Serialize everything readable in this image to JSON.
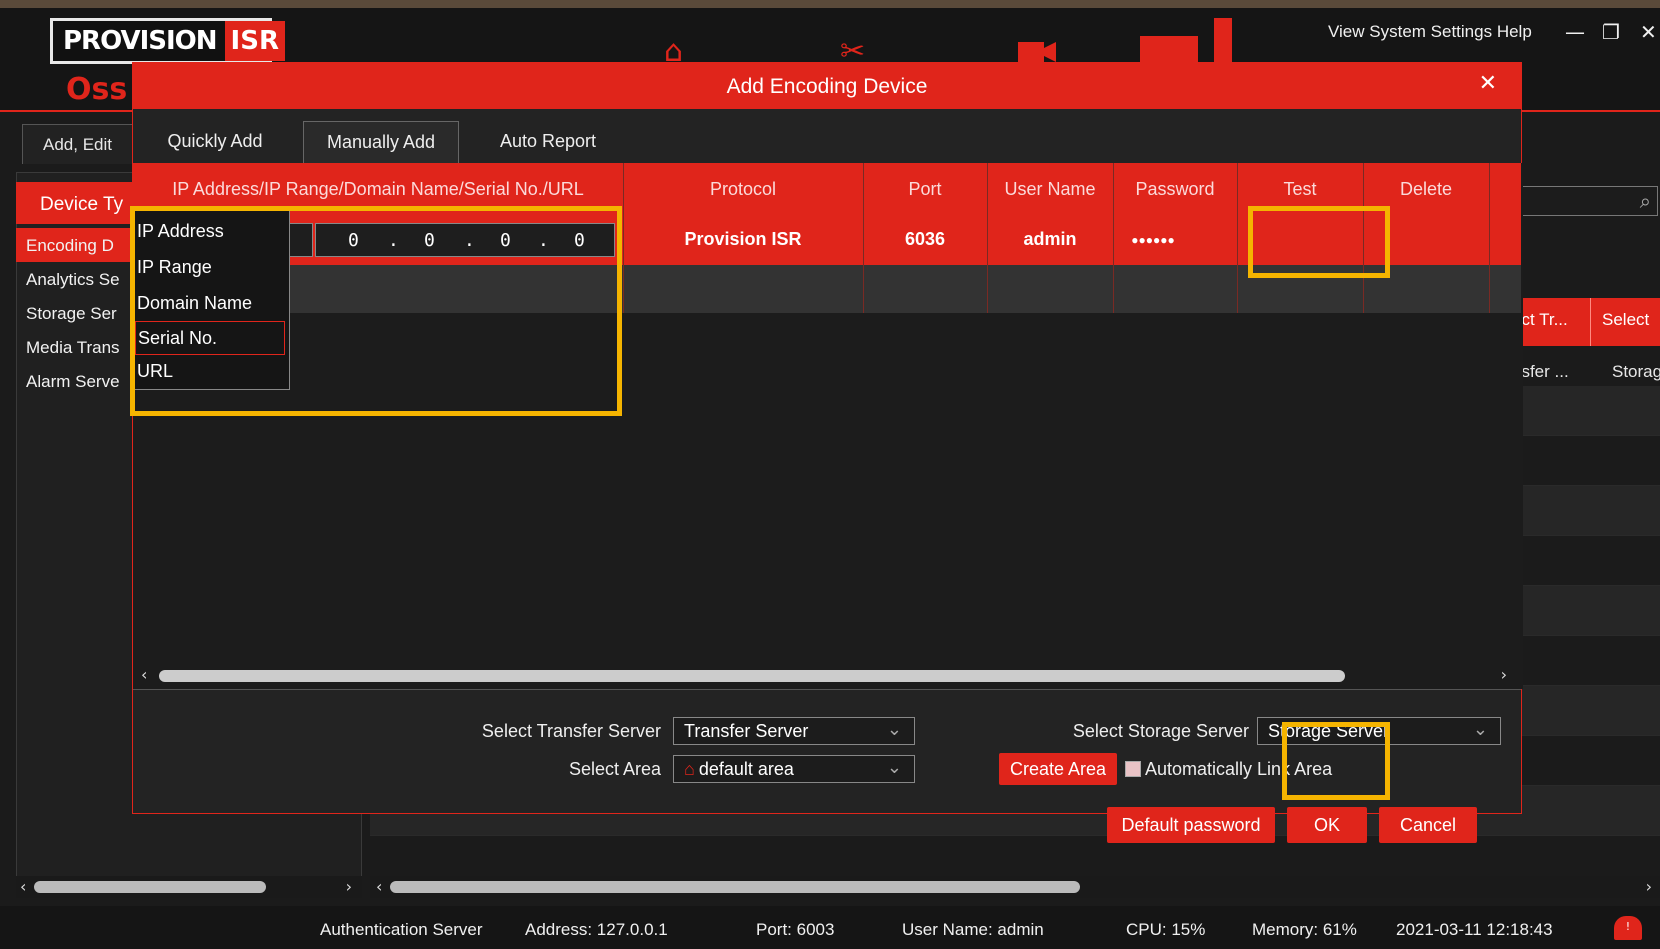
{
  "app": {
    "logo_text": "PROVISION",
    "logo_isr": "ISR",
    "app_name": "Oss",
    "system_menu": "View System Settings Help"
  },
  "sidebar": {
    "tab_label": "Add, Edit",
    "header": "Device Ty",
    "items": [
      {
        "label": "Encoding D"
      },
      {
        "label": "Analytics Se"
      },
      {
        "label": "Storage Ser"
      },
      {
        "label": "Media Trans"
      },
      {
        "label": "Alarm Serve"
      }
    ]
  },
  "right_panel": {
    "col1_header": "ect Tr...",
    "col2_header": "Select",
    "col1_value": "nsfer ...",
    "col2_value": "Storag"
  },
  "modal": {
    "title": "Add Encoding Device",
    "tabs": [
      {
        "label": "Quickly Add"
      },
      {
        "label": "Manually Add"
      },
      {
        "label": "Auto Report"
      }
    ],
    "columns": [
      "IP Address/IP Range/Domain Name/Serial No./URL",
      "Protocol",
      "Port",
      "User Name",
      "Password",
      "Test",
      "Delete"
    ],
    "row": {
      "ip_octets": [
        "0",
        "0",
        "0",
        "0"
      ],
      "protocol": "Provision ISR",
      "port": "6036",
      "username": "admin",
      "password": "●●●●●●"
    },
    "address_type_options": [
      "IP Address",
      "IP Range",
      "Domain Name",
      "Serial No.",
      "URL"
    ],
    "address_type_selected": "Serial No.",
    "footer": {
      "transfer_label": "Select Transfer Server",
      "transfer_value": "Transfer Server",
      "area_label": "Select Area",
      "area_value": "default area",
      "storage_label": "Select Storage Server",
      "storage_value": "Storage Server",
      "create_area": "Create Area",
      "auto_link": "Automatically Link Area",
      "default_password": "Default password",
      "ok": "OK",
      "cancel": "Cancel"
    }
  },
  "status": {
    "auth_server": "Authentication Server",
    "address": "Address: 127.0.0.1",
    "port": "Port: 6003",
    "user": "User Name: admin",
    "cpu": "CPU: 15%",
    "memory": "Memory: 61%",
    "datetime": "2021-03-11 12:18:43"
  },
  "colors": {
    "accent": "#e0251b",
    "highlight": "#f5b400"
  }
}
